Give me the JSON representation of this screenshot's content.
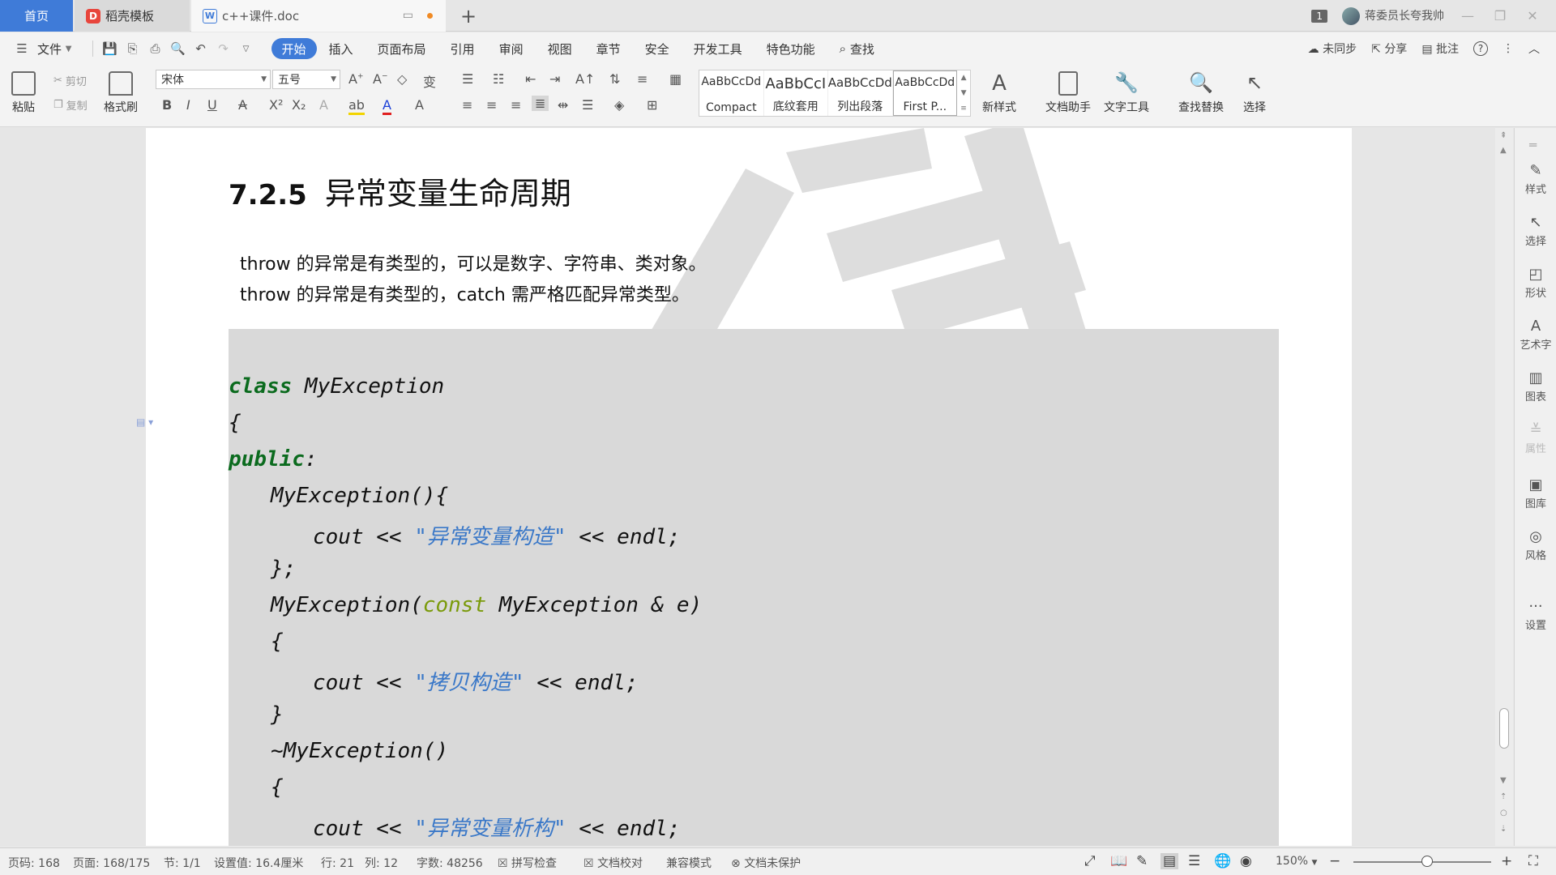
{
  "tabs": {
    "home": "首页",
    "template": "稻壳模板",
    "document": "c++课件.doc",
    "add": "+"
  },
  "window": {
    "badge": "1",
    "user": "蒋委员长夸我帅",
    "minimize": "—",
    "maximize": "❐",
    "close": "✕"
  },
  "menu": {
    "file": "文件",
    "items": [
      "开始",
      "插入",
      "页面布局",
      "引用",
      "审阅",
      "视图",
      "章节",
      "安全",
      "开发工具",
      "特色功能"
    ],
    "search": "查找",
    "sync": "未同步",
    "share": "分享",
    "comment": "批注",
    "help": "?"
  },
  "ribbon": {
    "paste": "粘贴",
    "cut": "剪切",
    "copy": "复制",
    "format_painter": "格式刷",
    "font_name": "宋体",
    "font_size": "五号",
    "styles": [
      {
        "preview": "AaBbCcDd",
        "name": "Compact"
      },
      {
        "preview": "AaBbCcI",
        "name": "底纹套用"
      },
      {
        "preview": "AaBbCcDd",
        "name": "列出段落"
      },
      {
        "preview": "AaBbCcDd",
        "name": "First P..."
      }
    ],
    "new_style": "新样式",
    "doc_assistant": "文档助手",
    "text_tools": "文字工具",
    "find_replace": "查找替换",
    "select": "选择"
  },
  "document": {
    "heading_num": "7.2.5",
    "heading_text": "异常变量生命周期",
    "para1": "throw 的异常是有类型的，可以是数字、字符串、类对象。",
    "para2": "throw 的异常是有类型的，catch 需严格匹配异常类型。",
    "code": {
      "l1_kw": "class",
      "l1_name": " MyException",
      "l2": "{",
      "l3_kw": "public",
      "l3_colon": ":",
      "l4": "MyException(){",
      "l5_pre": "cout << ",
      "l5_str": "\"异常变量构造\"",
      "l5_post": " << endl;",
      "l6": "};",
      "l7_pre": "MyException(",
      "l7_kw": "const",
      "l7_post": " MyException & e)",
      "l8": "{",
      "l9_pre": "cout << ",
      "l9_str": "\"拷贝构造\"",
      "l9_post": " << endl;",
      "l10": "}",
      "l11": "~MyException()",
      "l12": "{",
      "l13_pre": "cout << ",
      "l13_str": "\"异常变量析构\"",
      "l13_post": " << endl;"
    }
  },
  "sidepanel": [
    "样式",
    "选择",
    "形状",
    "艺术字",
    "图表",
    "属性",
    "图库",
    "风格",
    "设置"
  ],
  "status": {
    "page_code": "页码: 168",
    "pages": "页面: 168/175",
    "section": "节: 1/1",
    "setting": "设置值: 16.4厘米",
    "row": "行: 21",
    "col": "列: 12",
    "words": "字数: 48256",
    "spell": "拼写检查",
    "proof": "文档校对",
    "compat": "兼容模式",
    "protect": "文档未保护",
    "zoom": "150%"
  }
}
